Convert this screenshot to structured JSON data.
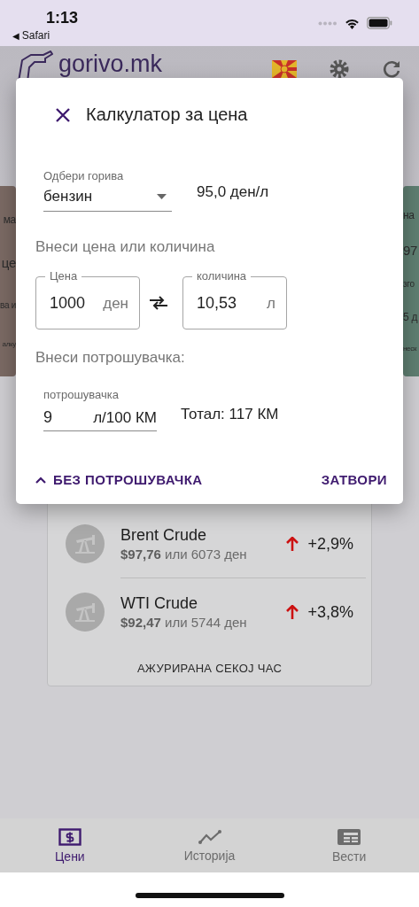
{
  "status_bar": {
    "time": "1:13",
    "back_arrow": "◀",
    "back_label": "Safari"
  },
  "header": {
    "logo": "gorivo.mk"
  },
  "carousel": [
    {
      "color": "#7b6a64",
      "lines": [
        {
          "kind": "title",
          "text": "ма"
        },
        {
          "kind": "big",
          "text": "це"
        },
        {
          "kind": "small",
          "text": "ва и"
        },
        {
          "kind": "tiny",
          "text": "алку"
        }
      ]
    },
    {
      "color": "#5f7f72",
      "lines": [
        {
          "kind": "title",
          "text": "на"
        },
        {
          "kind": "big",
          "text": "97"
        },
        {
          "kind": "small",
          "text": "зго"
        },
        {
          "kind": "title",
          "text": "5 д"
        },
        {
          "kind": "tiny",
          "text": "неск"
        }
      ]
    }
  ],
  "oil_card": {
    "items": [
      {
        "name": "Brent Crude",
        "price": "**$97,76** или 6073 ден",
        "change": "+2,9%"
      },
      {
        "name": "WTI Crude",
        "price": "**$92,47** или 5744 ден",
        "change": "+3,8%"
      }
    ],
    "footer": "АЖУРИРАНА СЕКОЈ ЧАС"
  },
  "dialog": {
    "title": "Калкулатор за цена",
    "fuel_select": {
      "label": "Одбери горива",
      "value": "бензин"
    },
    "unit_price": "95,0 ден/л",
    "amount_heading": "Внеси цена или количина",
    "price_field": {
      "label": "Цена",
      "value": "1000",
      "suffix": "ден"
    },
    "quantity_field": {
      "label": "количина",
      "value": "10,53",
      "suffix": "л"
    },
    "consumption_heading": "Внеси потрошувачка:",
    "consumption_field": {
      "label": "потрошувачка",
      "value": "9",
      "suffix": "л/100 КМ"
    },
    "total": "Тотал: 117 КМ",
    "toggle_button": "БЕЗ ПОТРОШУВАЧКА",
    "close_button": "ЗАТВОРИ"
  },
  "bottom_nav": [
    {
      "kind": "prices",
      "label": "Цени",
      "selected": true
    },
    {
      "kind": "history",
      "label": "Историја",
      "selected": false
    },
    {
      "kind": "news",
      "label": "Вести",
      "selected": false
    }
  ]
}
